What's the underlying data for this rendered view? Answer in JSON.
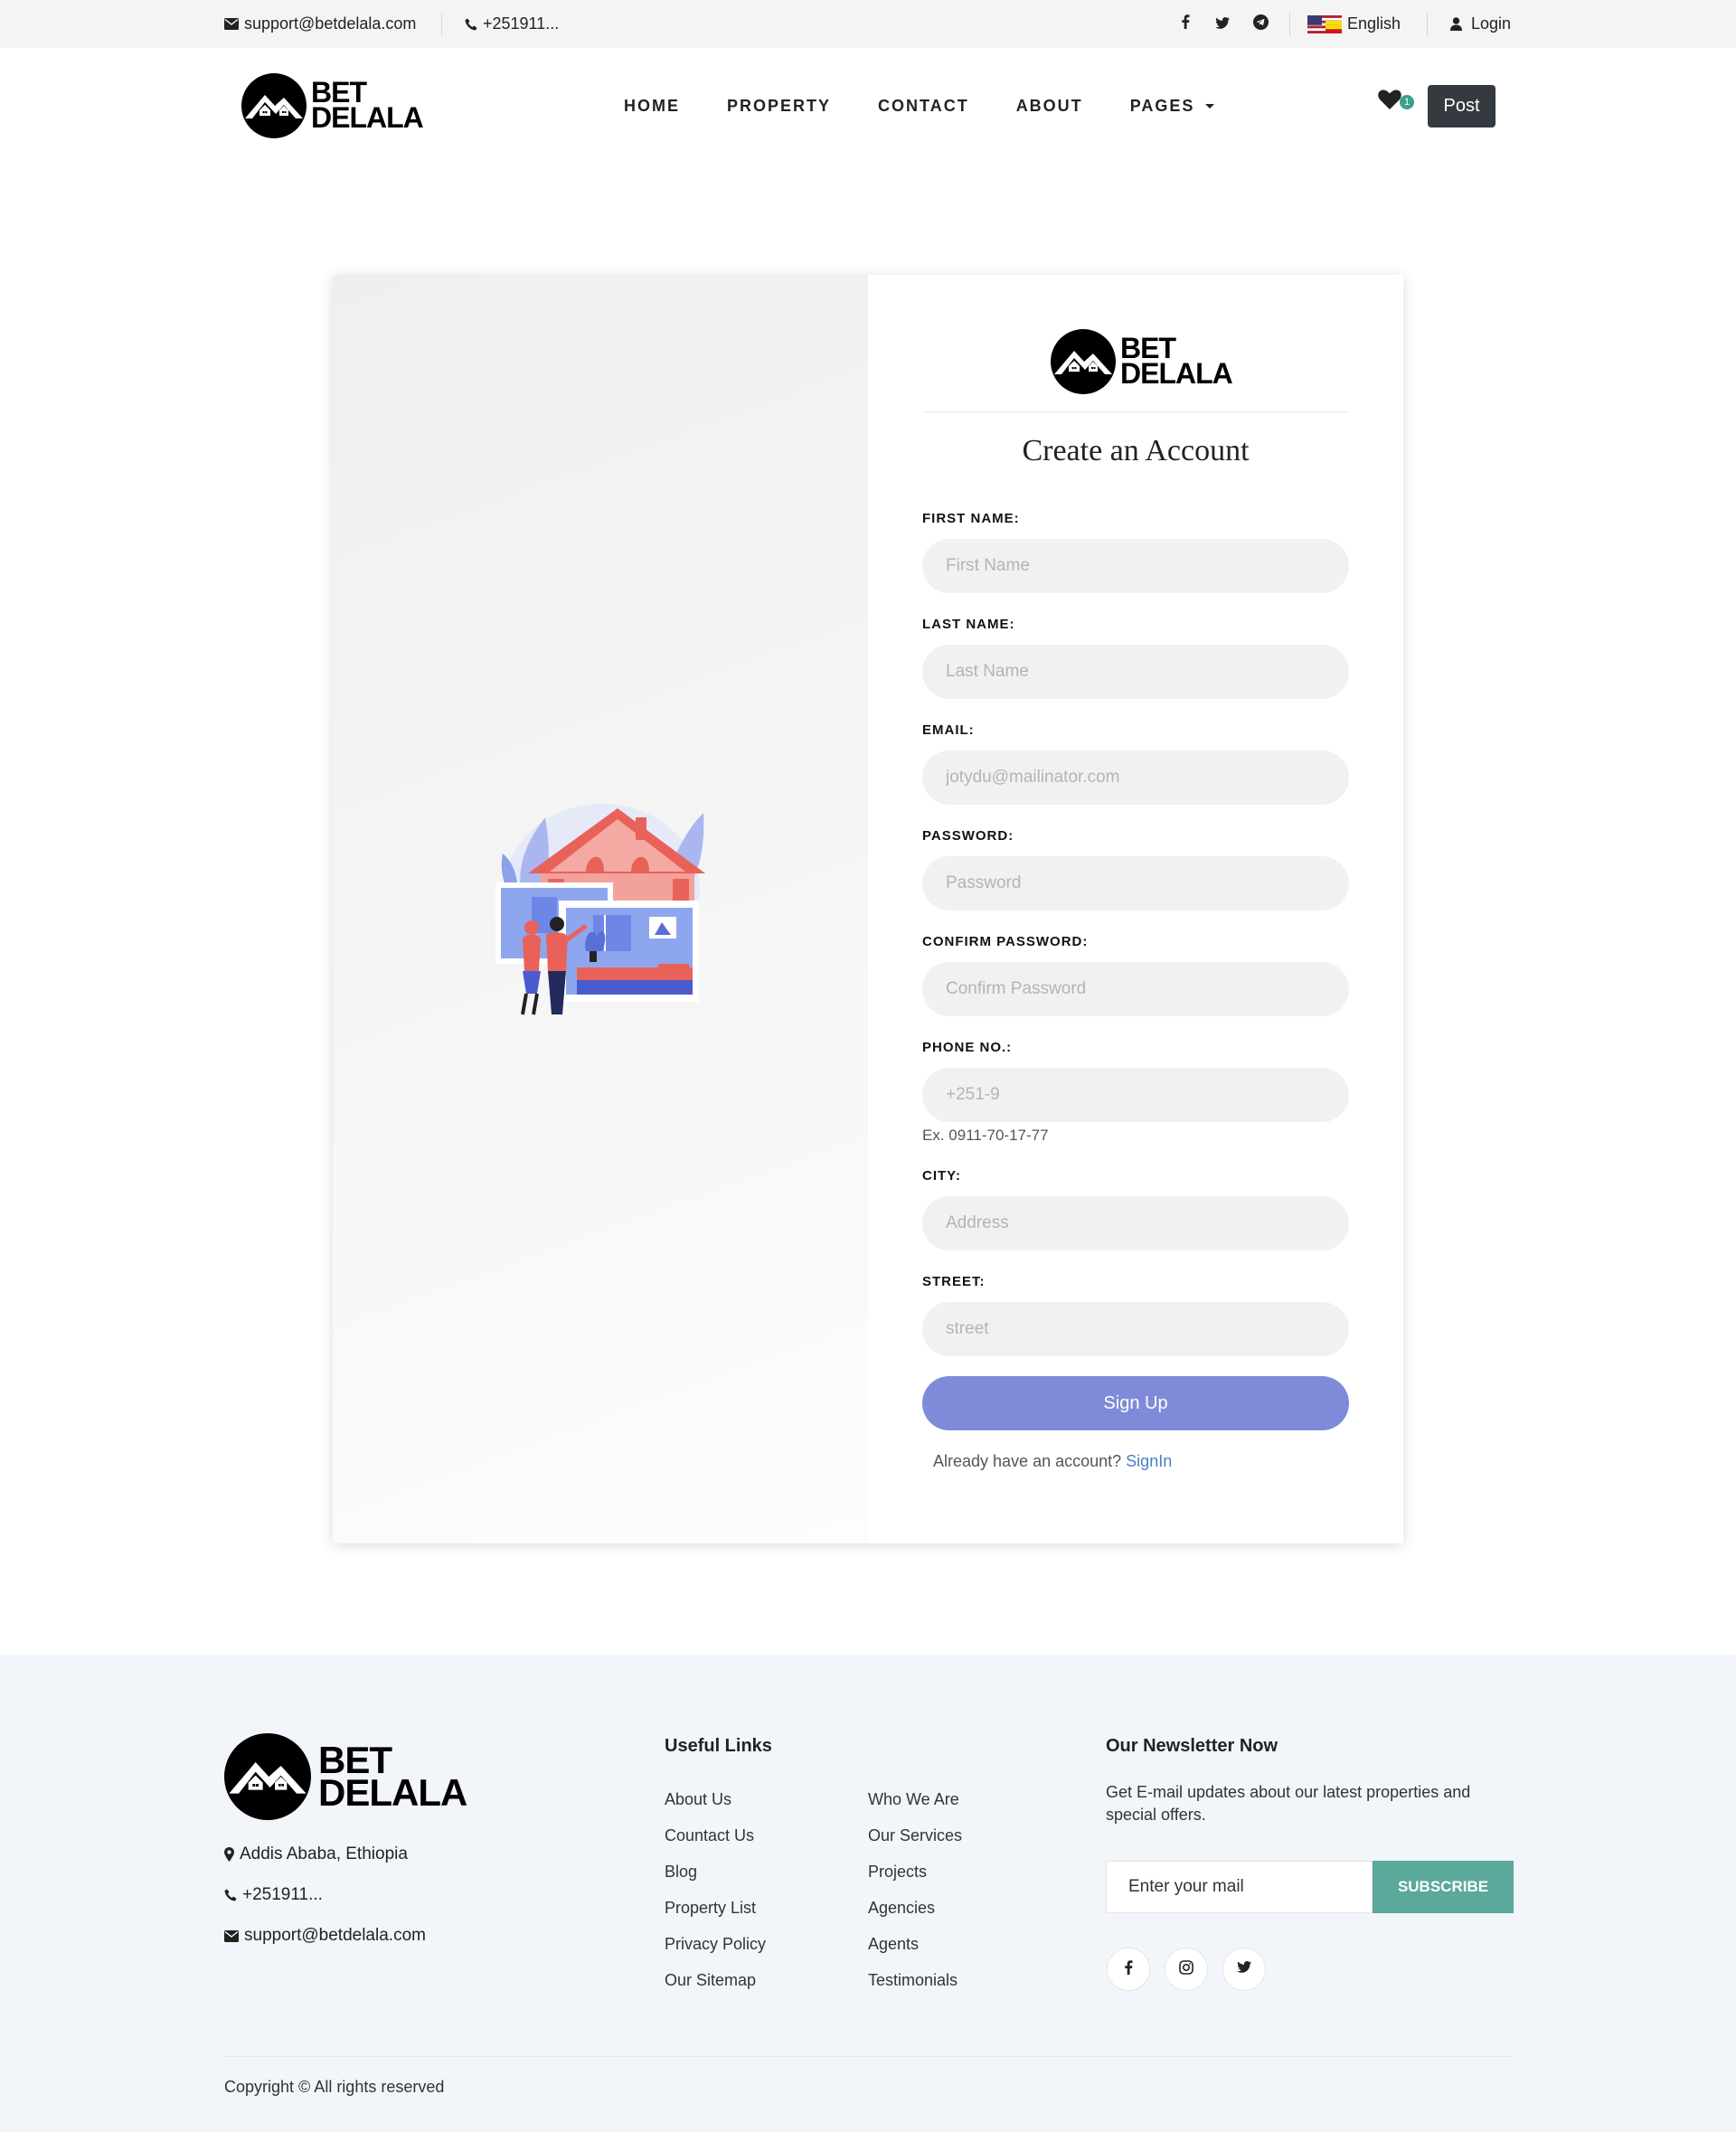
{
  "topbar": {
    "email": "support@betdelala.com",
    "phone": "+251911...",
    "language": "English",
    "login": "Login"
  },
  "brand": {
    "line1": "BET",
    "line2": "DELALA"
  },
  "nav": {
    "items": [
      "HOME",
      "PROPERTY",
      "CONTACT",
      "ABOUT",
      "PAGES"
    ],
    "favorites_count": "1",
    "post_label": "Post"
  },
  "form": {
    "title": "Create an Account",
    "fields": [
      {
        "label": "FIRST NAME:",
        "placeholder": "First Name"
      },
      {
        "label": "LAST NAME:",
        "placeholder": "Last Name"
      },
      {
        "label": "EMAIL:",
        "placeholder": "jotydu@mailinator.com"
      },
      {
        "label": "PASSWORD:",
        "placeholder": "Password"
      },
      {
        "label": "CONFIRM PASSWORD:",
        "placeholder": "Confirm Password"
      },
      {
        "label": "PHONE NO.:",
        "placeholder": "+251-9"
      },
      {
        "label": "CITY:",
        "placeholder": "Address"
      },
      {
        "label": "STREET:",
        "placeholder": "street"
      }
    ],
    "phone_help": "Ex. 0911-70-17-77",
    "submit": "Sign Up",
    "have_account": "Already have an account?",
    "signin": "SignIn"
  },
  "footer": {
    "address": "Addis Ababa, Ethiopia",
    "phone": "+251911...",
    "email": "support@betdelala.com",
    "useful_links_title": "Useful Links",
    "links_col1": [
      "About Us",
      "Countact Us",
      "Blog",
      "Property List",
      "Privacy Policy",
      "Our Sitemap"
    ],
    "links_col2": [
      "Who We Are",
      "Our Services",
      "Projects",
      "Agencies",
      "Agents",
      "Testimonials"
    ],
    "newsletter_title": "Our Newsletter Now",
    "newsletter_text": "Get E-mail updates about our latest properties and special offers.",
    "newsletter_placeholder": "Enter your mail",
    "subscribe": "SUBSCRIBE",
    "copyright": "Copyright © All rights reserved"
  },
  "colors": {
    "accent": "#7f8bd9",
    "subscribe": "#5ba99b",
    "post_button": "#343a40",
    "link": "#4a7fc1"
  }
}
